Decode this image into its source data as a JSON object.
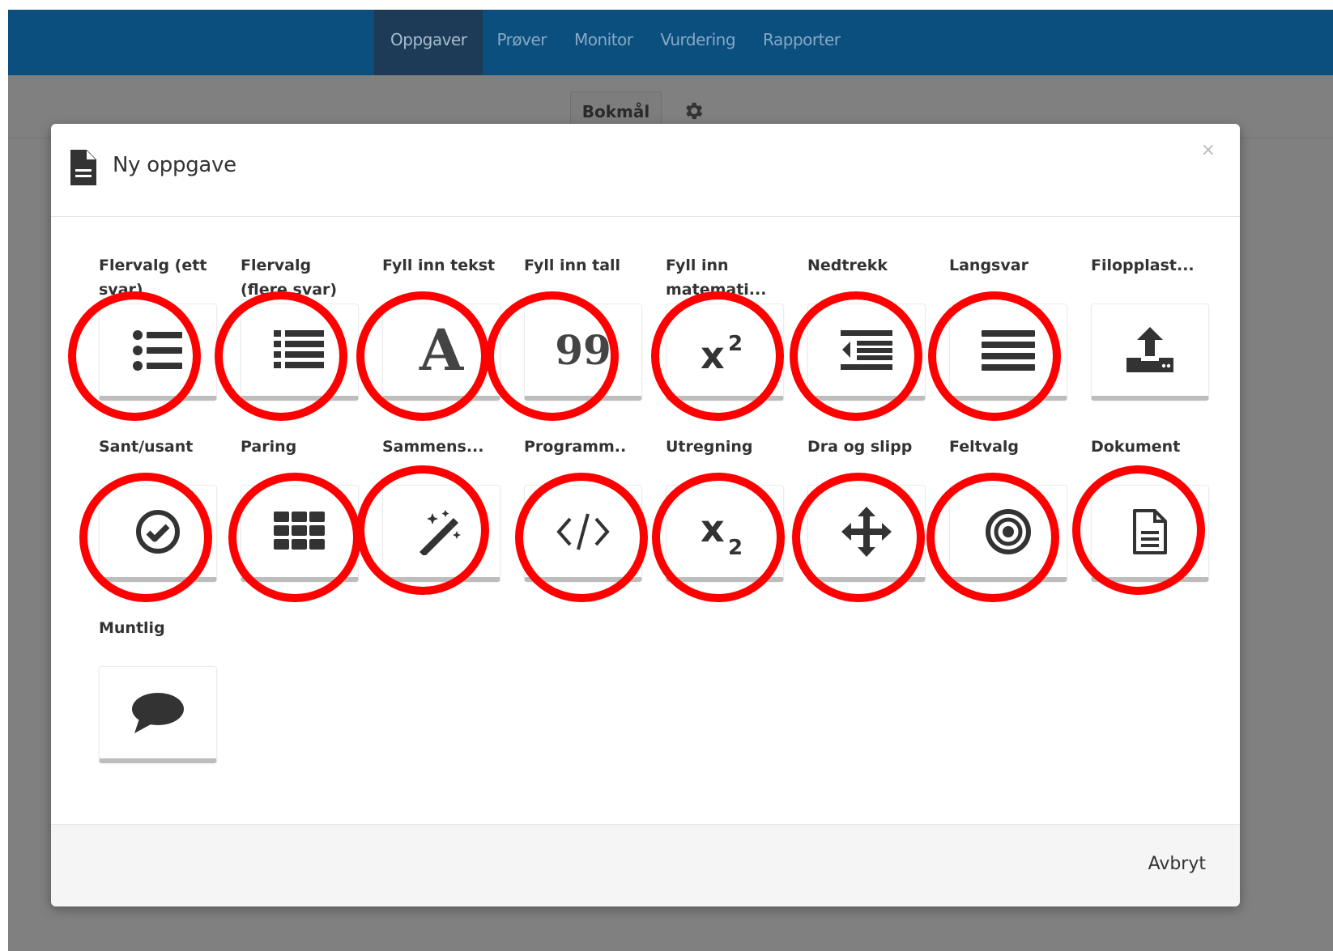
{
  "nav": {
    "tabs": [
      "Oppgaver",
      "Prøver",
      "Monitor",
      "Vurdering",
      "Rapporter"
    ],
    "active": "Oppgaver"
  },
  "toolbar": {
    "language_label": "Bokmål"
  },
  "modal": {
    "title": "Ny oppgave",
    "close_label": "×",
    "cancel_label": "Avbryt",
    "task_types": [
      {
        "label": "Flervalg (ett svar)",
        "icon": "list-ul-icon"
      },
      {
        "label": "Flervalg (flere svar)",
        "icon": "list-icon"
      },
      {
        "label": "Fyll inn tekst",
        "icon": "letter-a-icon"
      },
      {
        "label": "Fyll inn tall",
        "icon": "number-99-icon"
      },
      {
        "label": "Fyll inn matemati...",
        "icon": "superscript-icon"
      },
      {
        "label": "Nedtrekk",
        "icon": "outdent-icon"
      },
      {
        "label": "Langsvar",
        "icon": "paragraph-icon"
      },
      {
        "label": "Filopplast...",
        "icon": "upload-icon"
      },
      {
        "label": "Sant/usant",
        "icon": "check-circle-icon"
      },
      {
        "label": "Paring",
        "icon": "grid-icon"
      },
      {
        "label": "Sammens...",
        "icon": "magic-wand-icon"
      },
      {
        "label": "Programm..",
        "icon": "code-icon"
      },
      {
        "label": "Utregning",
        "icon": "subscript-icon"
      },
      {
        "label": "Dra og slipp",
        "icon": "move-arrows-icon"
      },
      {
        "label": "Feltvalg",
        "icon": "bullseye-icon"
      },
      {
        "label": "Dokument",
        "icon": "document-icon"
      },
      {
        "label": "Muntlig",
        "icon": "speech-bubble-icon"
      }
    ],
    "glyphs": {
      "letter": "A",
      "number": "99"
    }
  },
  "colors": {
    "nav_bg": "#0a4f7e",
    "nav_active_bg": "#1d3b56",
    "overlay": "#808080",
    "annotation": "#ff0000"
  }
}
